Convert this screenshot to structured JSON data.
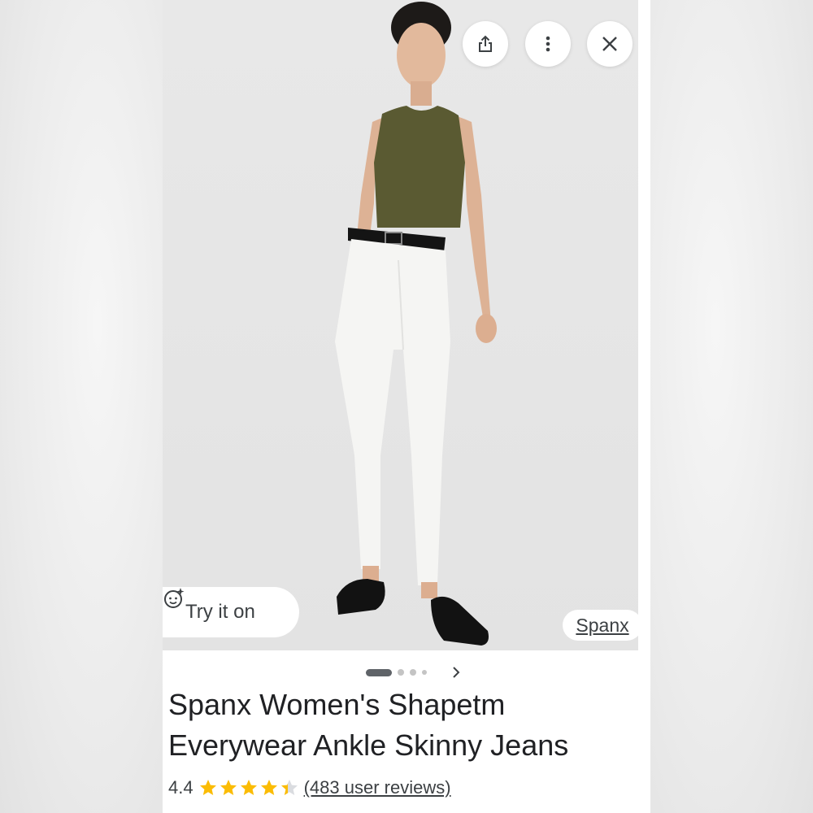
{
  "header_actions": {
    "share_icon": "share-icon",
    "more_icon": "more-vertical-icon",
    "close_icon": "close-icon"
  },
  "image_overlay": {
    "try_on_label": "Try it on",
    "try_on_icon": "sparkle-face-icon",
    "brand_link": "Spanx"
  },
  "gallery": {
    "total_images": 4,
    "current_index": 1,
    "next_icon": "chevron-right-icon"
  },
  "product": {
    "title_line1": "Spanx Women's Shapetm",
    "title_line2": "Everywear Ankle Skinny Jeans",
    "rating": "4.4",
    "rating_value": 4.4,
    "stars_max": 5,
    "reviews_label": "(483 user reviews)"
  },
  "colors": {
    "star": "#fbbc04",
    "star_empty": "#dadce0",
    "text_primary": "#202124",
    "text_secondary": "#3c4043"
  }
}
